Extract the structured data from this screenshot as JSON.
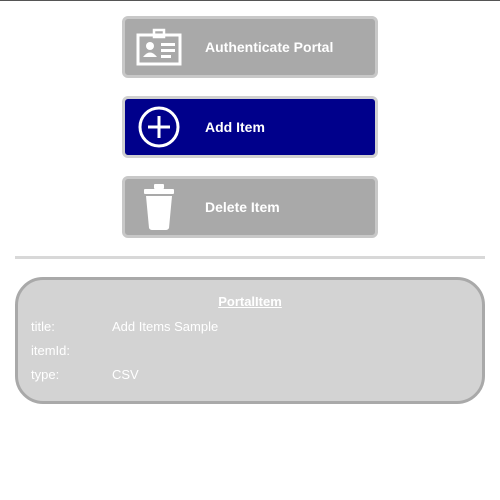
{
  "buttons": {
    "authenticate": {
      "label": "Authenticate Portal",
      "icon": "id-card-icon"
    },
    "add": {
      "label": "Add Item",
      "icon": "plus-circle-icon"
    },
    "delete": {
      "label": "Delete Item",
      "icon": "trash-icon"
    }
  },
  "portal_item": {
    "heading": "PortalItem",
    "fields": [
      {
        "key": "title:",
        "value": "Add Items Sample"
      },
      {
        "key": "itemId:",
        "value": ""
      },
      {
        "key": "type:",
        "value": "CSV"
      }
    ]
  },
  "colors": {
    "button_disabled": "#a9a9a9",
    "button_active": "#00008b",
    "card_background": "#d3d3d3",
    "text": "#ffffff"
  }
}
